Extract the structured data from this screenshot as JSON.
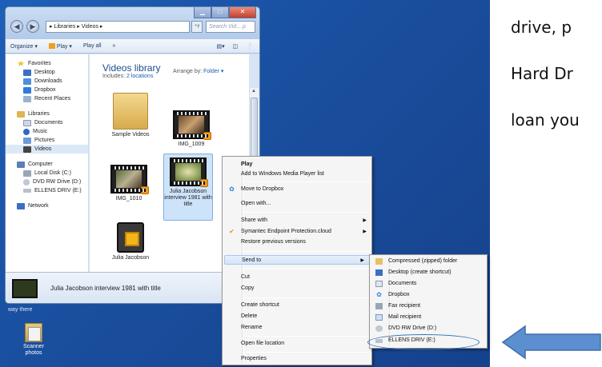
{
  "window": {
    "address": "▸ Libraries ▸ Videos ▸",
    "address_refresh": "⁺ʸ",
    "search_placeholder": "Search Vid... ρ",
    "controls": [
      "▁",
      "□",
      "✕"
    ]
  },
  "toolbar": {
    "organize": "Organize ▾",
    "play": "Play ▾",
    "play_all": "Play all",
    "more": "»"
  },
  "nav": {
    "favorites": {
      "label": "Favorites",
      "items": [
        "Desktop",
        "Downloads",
        "Dropbox",
        "Recent Places"
      ]
    },
    "libraries": {
      "label": "Libraries",
      "items": [
        "Documents",
        "Music",
        "Pictures",
        "Videos"
      ]
    },
    "computer": {
      "label": "Computer",
      "items": [
        "Local Disk (C:)",
        "DVD RW Drive (D:)",
        "ELLENS DRIV (E:)"
      ]
    },
    "network": {
      "label": "Network"
    }
  },
  "library": {
    "title": "Videos library",
    "includes_prefix": "Includes:",
    "includes_link": "2 locations",
    "arrange_prefix": "Arrange by:",
    "arrange_value": "Folder ▾"
  },
  "files": [
    {
      "name": "Sample Videos"
    },
    {
      "name": "IMG_1009"
    },
    {
      "name": "IMG_1010"
    },
    {
      "name": "Julia Jacobson interview 1981 with title"
    },
    {
      "name": "Julia Jacobson"
    }
  ],
  "details": {
    "name": "Julia Jacobson interview 1981 with title"
  },
  "context_menu": {
    "items": [
      {
        "label": "Play",
        "bold": true
      },
      {
        "label": "Add to Windows Media Player list"
      },
      {
        "label": "Move to Dropbox",
        "icon": "dropbox-icon"
      },
      {
        "label": "Open with..."
      },
      {
        "label": "Share with",
        "submenu": true
      },
      {
        "label": "Symantec Endpoint Protection.cloud",
        "submenu": true,
        "icon": "check-icon"
      },
      {
        "label": "Restore previous versions"
      },
      {
        "label": "Send to",
        "submenu": true,
        "highlighted": true
      },
      {
        "label": "Cut"
      },
      {
        "label": "Copy"
      },
      {
        "label": "Create shortcut"
      },
      {
        "label": "Delete"
      },
      {
        "label": "Rename"
      },
      {
        "label": "Open file location"
      },
      {
        "label": "Properties"
      }
    ]
  },
  "sendto_menu": {
    "items": [
      "Compressed (zipped) folder",
      "Desktop (create shortcut)",
      "Documents",
      "Dropbox",
      "Fax recipient",
      "Mail recipient",
      "DVD RW Drive (D:)",
      "ELLENS DRIV (E:)"
    ]
  },
  "desktop": {
    "partial_text": "way there",
    "icon_label": "Scanner photos"
  },
  "document": {
    "lines": [
      "drive, p",
      "Hard Dr",
      "loan you"
    ]
  },
  "colors": {
    "desktop": "#1a50a0",
    "arrow": "#5b8fd0",
    "highlight_oval": "#2f6fb0"
  }
}
